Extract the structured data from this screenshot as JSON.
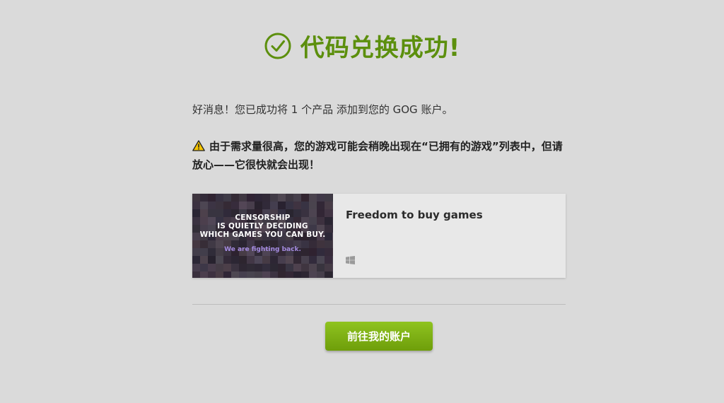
{
  "header": {
    "title": "代码兑换成功!",
    "icon": "check-circle-icon",
    "title_color": "#5c8f0d"
  },
  "message": {
    "good_news": "好消息！您已成功将 1 个产品 添加到您的 GOG 账户。",
    "warning_icon": "warning-triangle-icon",
    "warning": "由于需求量很高，您的游戏可能会稍晚出现在“已拥有的游戏”列表中，但请放心——它很快就会出现！"
  },
  "product": {
    "name": "Freedom to buy games",
    "platform_icon": "windows-icon",
    "thumbnail": {
      "line1": "CENSORSHIP",
      "line2": "IS QUIETLY DECIDING",
      "line3": "WHICH GAMES YOU CAN BUY.",
      "subline": "We are fighting back."
    }
  },
  "actions": {
    "account_button": "前往我的账户",
    "button_color": "#7cb214"
  }
}
